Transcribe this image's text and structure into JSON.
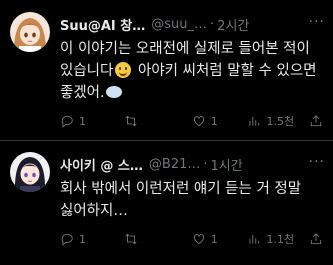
{
  "tweets": [
    {
      "name": "Suu@AI 창…",
      "handle": "@suu_…",
      "time": "2시간",
      "text_part1": "이 이야기는 오래전에 실제로 들어본 적이 있습니다",
      "text_part2": " 아야키 씨처럼 말할 수 있으면 좋겠어.",
      "reply_count": "1",
      "retweet_count": "",
      "like_count": "1",
      "views": "1.5천",
      "icons": [
        "reply-icon",
        "retweet-icon",
        "like-icon",
        "views-icon",
        "share-icon"
      ]
    },
    {
      "name": "사이키 @ 스…",
      "handle": "@B21…",
      "time": "1시간",
      "text": "회사 밖에서 이런저런 얘기 듣는 거 정말 싫어하지…",
      "reply_count": "1",
      "retweet_count": "",
      "like_count": "1",
      "views": "1.1천",
      "icons": [
        "reply-icon",
        "retweet-icon",
        "like-icon",
        "views-icon",
        "share-icon"
      ]
    }
  ],
  "colors": {
    "background": "#000000",
    "text": "#e7e9ea",
    "muted": "#71767b",
    "divider": "#2f3336"
  }
}
